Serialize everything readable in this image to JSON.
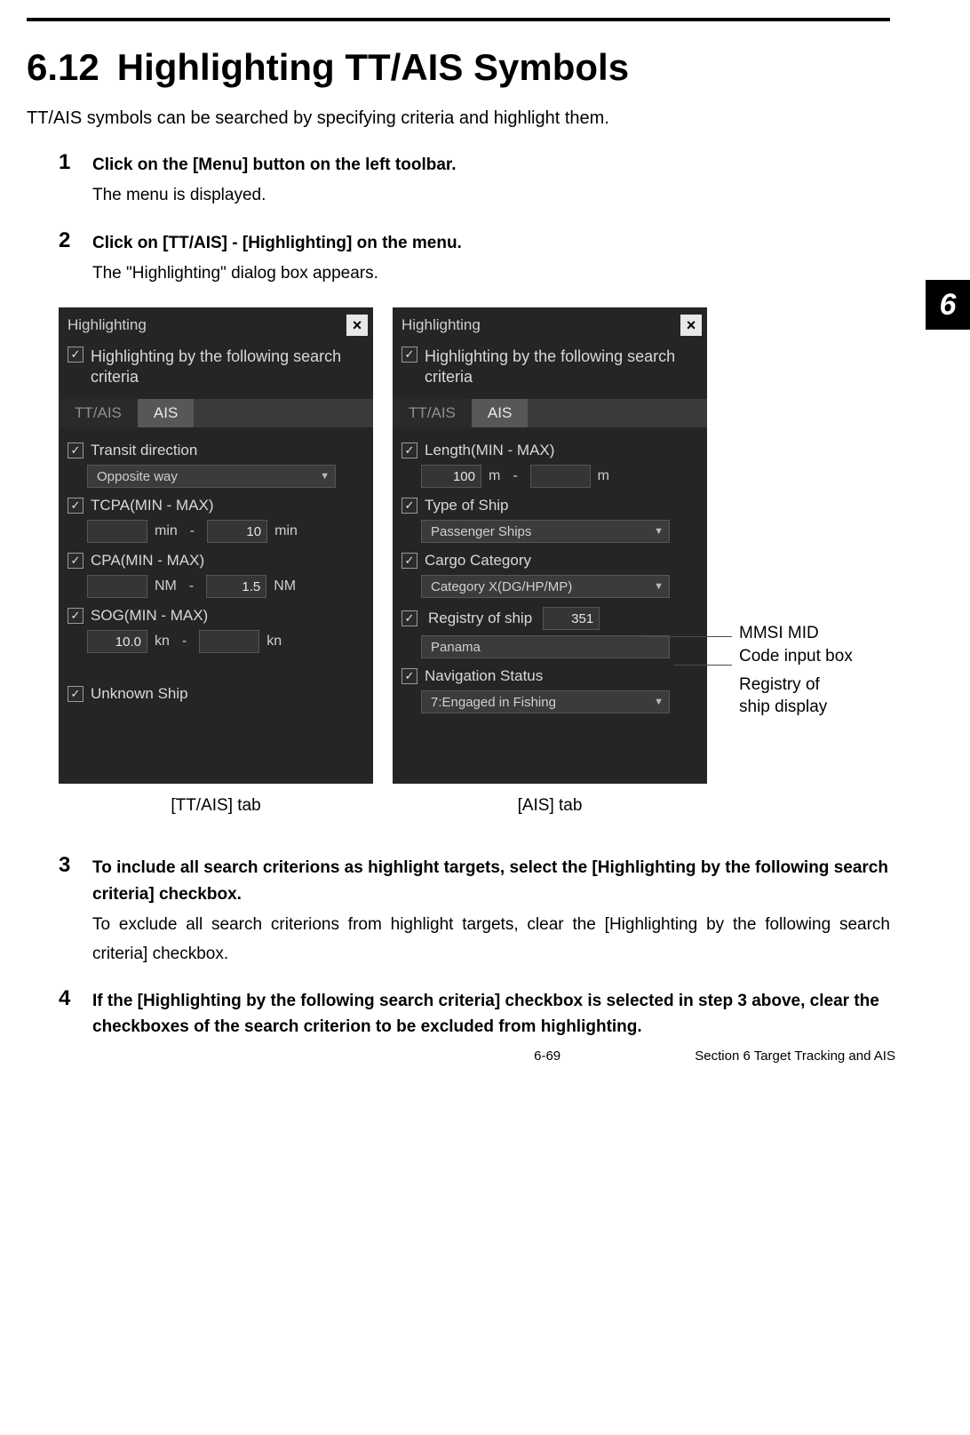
{
  "sideTab": "6",
  "heading": {
    "num": "6.12",
    "title": "Highlighting TT/AIS Symbols"
  },
  "intro": "TT/AIS symbols can be searched by specifying criteria and highlight them.",
  "steps": [
    {
      "n": "1",
      "bold": "Click on the [Menu] button on the left toolbar.",
      "plain": "The menu is displayed."
    },
    {
      "n": "2",
      "bold": "Click on [TT/AIS] - [Highlighting] on the menu.",
      "plain": "The \"Highlighting\" dialog box appears."
    },
    {
      "n": "3",
      "bold": "To include all search criterions as highlight targets, select the [Highlighting by the following search criteria] checkbox.",
      "plain": "To exclude all search criterions from highlight targets, clear the [Highlighting by the following search criteria] checkbox."
    },
    {
      "n": "4",
      "bold": "If the [Highlighting by the following search criteria] checkbox is selected in step 3 above, clear the checkboxes of the search criterion to be excluded from highlighting.",
      "plain": ""
    }
  ],
  "dialog_left": {
    "title": "Highlighting",
    "master": "Highlighting by the following search criteria",
    "tab_inactive": "TT/AIS",
    "tab_active": "AIS",
    "criteria": {
      "transit": {
        "label": "Transit direction",
        "value": "Opposite way"
      },
      "tcpa": {
        "label": "TCPA(MIN - MAX)",
        "v1": "",
        "u1": "min",
        "v2": "10",
        "u2": "min"
      },
      "cpa": {
        "label": "CPA(MIN - MAX)",
        "v1": "",
        "u1": "NM",
        "v2": "1.5",
        "u2": "NM"
      },
      "sog": {
        "label": "SOG(MIN - MAX)",
        "v1": "10.0",
        "u1": "kn",
        "v2": "",
        "u2": "kn"
      },
      "unknown": {
        "label": "Unknown Ship"
      }
    },
    "caption": "[TT/AIS] tab"
  },
  "dialog_right": {
    "title": "Highlighting",
    "master": "Highlighting by the following search criteria",
    "tab_inactive": "TT/AIS",
    "tab_active": "AIS",
    "criteria": {
      "length": {
        "label": "Length(MIN - MAX)",
        "v1": "100",
        "u1": "m",
        "v2": "",
        "u2": "m"
      },
      "type": {
        "label": "Type of Ship",
        "value": "Passenger Ships"
      },
      "cargo": {
        "label": "Cargo Category",
        "value": "Category X(DG/HP/MP)"
      },
      "reg": {
        "label": "Registry of ship",
        "mmsi": "351",
        "country": "Panama"
      },
      "nav": {
        "label": "Navigation Status",
        "value": "7:Engaged in Fishing"
      }
    },
    "caption": "[AIS] tab"
  },
  "callouts": {
    "a": "MMSI MID Code input box",
    "b": "Registry of ship display"
  },
  "footer": {
    "page": "6-69",
    "section": "Section 6    Target Tracking and AIS"
  }
}
